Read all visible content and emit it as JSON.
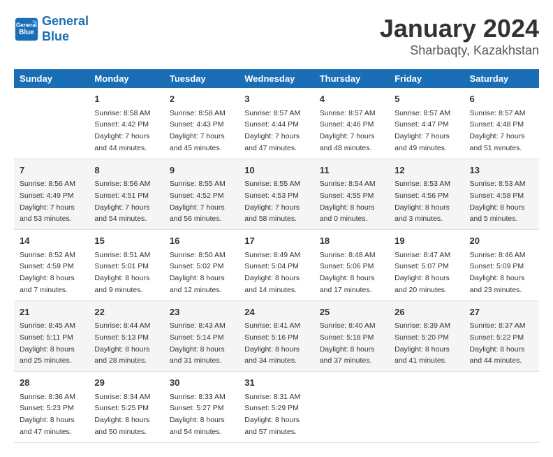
{
  "header": {
    "logo_line1": "General",
    "logo_line2": "Blue",
    "month": "January 2024",
    "location": "Sharbaqty, Kazakhstan"
  },
  "days_of_week": [
    "Sunday",
    "Monday",
    "Tuesday",
    "Wednesday",
    "Thursday",
    "Friday",
    "Saturday"
  ],
  "weeks": [
    [
      {
        "day": "",
        "sunrise": "",
        "sunset": "",
        "daylight": ""
      },
      {
        "day": "1",
        "sunrise": "Sunrise: 8:58 AM",
        "sunset": "Sunset: 4:42 PM",
        "daylight": "Daylight: 7 hours and 44 minutes."
      },
      {
        "day": "2",
        "sunrise": "Sunrise: 8:58 AM",
        "sunset": "Sunset: 4:43 PM",
        "daylight": "Daylight: 7 hours and 45 minutes."
      },
      {
        "day": "3",
        "sunrise": "Sunrise: 8:57 AM",
        "sunset": "Sunset: 4:44 PM",
        "daylight": "Daylight: 7 hours and 47 minutes."
      },
      {
        "day": "4",
        "sunrise": "Sunrise: 8:57 AM",
        "sunset": "Sunset: 4:46 PM",
        "daylight": "Daylight: 7 hours and 48 minutes."
      },
      {
        "day": "5",
        "sunrise": "Sunrise: 8:57 AM",
        "sunset": "Sunset: 4:47 PM",
        "daylight": "Daylight: 7 hours and 49 minutes."
      },
      {
        "day": "6",
        "sunrise": "Sunrise: 8:57 AM",
        "sunset": "Sunset: 4:48 PM",
        "daylight": "Daylight: 7 hours and 51 minutes."
      }
    ],
    [
      {
        "day": "7",
        "sunrise": "Sunrise: 8:56 AM",
        "sunset": "Sunset: 4:49 PM",
        "daylight": "Daylight: 7 hours and 53 minutes."
      },
      {
        "day": "8",
        "sunrise": "Sunrise: 8:56 AM",
        "sunset": "Sunset: 4:51 PM",
        "daylight": "Daylight: 7 hours and 54 minutes."
      },
      {
        "day": "9",
        "sunrise": "Sunrise: 8:55 AM",
        "sunset": "Sunset: 4:52 PM",
        "daylight": "Daylight: 7 hours and 56 minutes."
      },
      {
        "day": "10",
        "sunrise": "Sunrise: 8:55 AM",
        "sunset": "Sunset: 4:53 PM",
        "daylight": "Daylight: 7 hours and 58 minutes."
      },
      {
        "day": "11",
        "sunrise": "Sunrise: 8:54 AM",
        "sunset": "Sunset: 4:55 PM",
        "daylight": "Daylight: 8 hours and 0 minutes."
      },
      {
        "day": "12",
        "sunrise": "Sunrise: 8:53 AM",
        "sunset": "Sunset: 4:56 PM",
        "daylight": "Daylight: 8 hours and 3 minutes."
      },
      {
        "day": "13",
        "sunrise": "Sunrise: 8:53 AM",
        "sunset": "Sunset: 4:58 PM",
        "daylight": "Daylight: 8 hours and 5 minutes."
      }
    ],
    [
      {
        "day": "14",
        "sunrise": "Sunrise: 8:52 AM",
        "sunset": "Sunset: 4:59 PM",
        "daylight": "Daylight: 8 hours and 7 minutes."
      },
      {
        "day": "15",
        "sunrise": "Sunrise: 8:51 AM",
        "sunset": "Sunset: 5:01 PM",
        "daylight": "Daylight: 8 hours and 9 minutes."
      },
      {
        "day": "16",
        "sunrise": "Sunrise: 8:50 AM",
        "sunset": "Sunset: 5:02 PM",
        "daylight": "Daylight: 8 hours and 12 minutes."
      },
      {
        "day": "17",
        "sunrise": "Sunrise: 8:49 AM",
        "sunset": "Sunset: 5:04 PM",
        "daylight": "Daylight: 8 hours and 14 minutes."
      },
      {
        "day": "18",
        "sunrise": "Sunrise: 8:48 AM",
        "sunset": "Sunset: 5:06 PM",
        "daylight": "Daylight: 8 hours and 17 minutes."
      },
      {
        "day": "19",
        "sunrise": "Sunrise: 8:47 AM",
        "sunset": "Sunset: 5:07 PM",
        "daylight": "Daylight: 8 hours and 20 minutes."
      },
      {
        "day": "20",
        "sunrise": "Sunrise: 8:46 AM",
        "sunset": "Sunset: 5:09 PM",
        "daylight": "Daylight: 8 hours and 23 minutes."
      }
    ],
    [
      {
        "day": "21",
        "sunrise": "Sunrise: 8:45 AM",
        "sunset": "Sunset: 5:11 PM",
        "daylight": "Daylight: 8 hours and 25 minutes."
      },
      {
        "day": "22",
        "sunrise": "Sunrise: 8:44 AM",
        "sunset": "Sunset: 5:13 PM",
        "daylight": "Daylight: 8 hours and 28 minutes."
      },
      {
        "day": "23",
        "sunrise": "Sunrise: 8:43 AM",
        "sunset": "Sunset: 5:14 PM",
        "daylight": "Daylight: 8 hours and 31 minutes."
      },
      {
        "day": "24",
        "sunrise": "Sunrise: 8:41 AM",
        "sunset": "Sunset: 5:16 PM",
        "daylight": "Daylight: 8 hours and 34 minutes."
      },
      {
        "day": "25",
        "sunrise": "Sunrise: 8:40 AM",
        "sunset": "Sunset: 5:18 PM",
        "daylight": "Daylight: 8 hours and 37 minutes."
      },
      {
        "day": "26",
        "sunrise": "Sunrise: 8:39 AM",
        "sunset": "Sunset: 5:20 PM",
        "daylight": "Daylight: 8 hours and 41 minutes."
      },
      {
        "day": "27",
        "sunrise": "Sunrise: 8:37 AM",
        "sunset": "Sunset: 5:22 PM",
        "daylight": "Daylight: 8 hours and 44 minutes."
      }
    ],
    [
      {
        "day": "28",
        "sunrise": "Sunrise: 8:36 AM",
        "sunset": "Sunset: 5:23 PM",
        "daylight": "Daylight: 8 hours and 47 minutes."
      },
      {
        "day": "29",
        "sunrise": "Sunrise: 8:34 AM",
        "sunset": "Sunset: 5:25 PM",
        "daylight": "Daylight: 8 hours and 50 minutes."
      },
      {
        "day": "30",
        "sunrise": "Sunrise: 8:33 AM",
        "sunset": "Sunset: 5:27 PM",
        "daylight": "Daylight: 8 hours and 54 minutes."
      },
      {
        "day": "31",
        "sunrise": "Sunrise: 8:31 AM",
        "sunset": "Sunset: 5:29 PM",
        "daylight": "Daylight: 8 hours and 57 minutes."
      },
      {
        "day": "",
        "sunrise": "",
        "sunset": "",
        "daylight": ""
      },
      {
        "day": "",
        "sunrise": "",
        "sunset": "",
        "daylight": ""
      },
      {
        "day": "",
        "sunrise": "",
        "sunset": "",
        "daylight": ""
      }
    ]
  ]
}
